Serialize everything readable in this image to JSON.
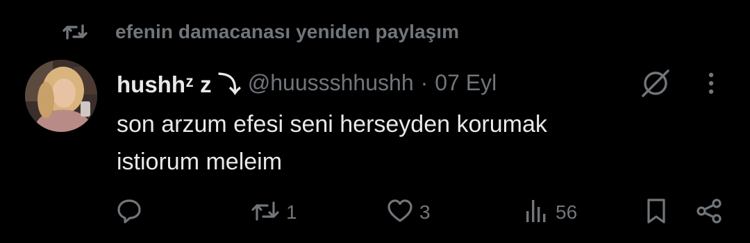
{
  "repost_header": {
    "text": "efenin damacanası yeniden paylaşım",
    "icon": "repost-icon"
  },
  "tweet": {
    "display_name": "hushhᶻ z ⤵",
    "handle": "@huussshhushh",
    "separator": "·",
    "date": "07 Eyl",
    "text_line1": "son arzum efesi seni herseyden korumak",
    "text_line2": "istiorum meleim"
  },
  "actions": {
    "reply": {
      "icon": "reply-icon",
      "count": ""
    },
    "repost": {
      "icon": "repost-icon",
      "count": "1"
    },
    "like": {
      "icon": "heart-icon",
      "count": "3"
    },
    "views": {
      "icon": "views-icon",
      "count": "56"
    },
    "bookmark": {
      "icon": "bookmark-icon"
    },
    "share": {
      "icon": "share-icon"
    }
  },
  "colors": {
    "background": "#000000",
    "primary_text": "#e7e9ea",
    "secondary_text": "#71767b"
  }
}
